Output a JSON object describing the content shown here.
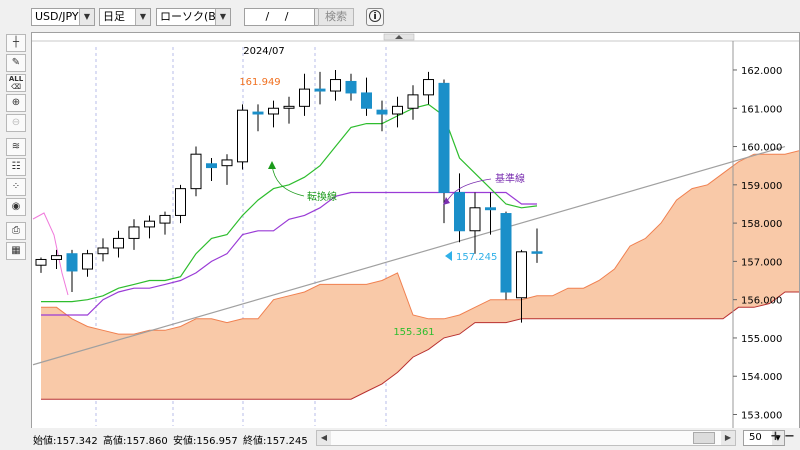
{
  "toolbar": {
    "symbol": "USD/JPY",
    "period": "日足",
    "chart_type": "ローソク(BID)",
    "date": "/ /",
    "search_label": "検索",
    "info_icon": "info-icon"
  },
  "sidebar": {
    "icons": [
      "crosshair-icon",
      "pencil-icon",
      "all-delete-icon",
      "zoom-in-icon",
      "zoom-out-icon",
      "technical-chart-icon",
      "list-icon",
      "grid-icon",
      "eye-icon",
      "print-icon",
      "calculator-icon"
    ],
    "all_label": "ALL"
  },
  "chart": {
    "date_label": "2024/07",
    "price_axis": [
      "162.000",
      "161.000",
      "160.000",
      "159.000",
      "158.000",
      "157.000",
      "156.000",
      "155.000",
      "154.000",
      "153.000"
    ],
    "high_label": "161.949",
    "low_label": "155.361",
    "current_label": "157.245",
    "kijun_label": "基準線",
    "tenkan_label": "転換線",
    "colors": {
      "up": "#ffffff",
      "down": "#1a8fc9",
      "tenkan": "#2ebd2e",
      "kijun": "#9a3bd6",
      "cloud": "#f9c9a8",
      "cloud_edge_a": "#f08050",
      "cloud_edge_b": "#b83030",
      "trend": "#a0a0a0",
      "high": "#f07020",
      "low": "#2ebd2e",
      "current": "#30b0e8"
    }
  },
  "chart_data": {
    "type": "candlestick",
    "ylim": [
      152.7,
      162.6
    ],
    "candles": [
      {
        "o": 156.9,
        "h": 157.1,
        "l": 156.7,
        "c": 157.05
      },
      {
        "o": 157.05,
        "h": 157.3,
        "l": 156.8,
        "c": 157.15
      },
      {
        "o": 157.2,
        "h": 157.3,
        "l": 156.2,
        "c": 156.75
      },
      {
        "o": 156.8,
        "h": 157.3,
        "l": 156.6,
        "c": 157.2
      },
      {
        "o": 157.2,
        "h": 157.6,
        "l": 157.0,
        "c": 157.35
      },
      {
        "o": 157.35,
        "h": 157.8,
        "l": 157.1,
        "c": 157.6
      },
      {
        "o": 157.6,
        "h": 158.1,
        "l": 157.3,
        "c": 157.9
      },
      {
        "o": 157.9,
        "h": 158.2,
        "l": 157.6,
        "c": 158.05
      },
      {
        "o": 158.0,
        "h": 158.3,
        "l": 157.7,
        "c": 158.2
      },
      {
        "o": 158.2,
        "h": 159.0,
        "l": 158.0,
        "c": 158.9
      },
      {
        "o": 158.9,
        "h": 160.0,
        "l": 158.7,
        "c": 159.8
      },
      {
        "o": 159.55,
        "h": 159.7,
        "l": 159.1,
        "c": 159.45
      },
      {
        "o": 159.5,
        "h": 159.8,
        "l": 159.0,
        "c": 159.65
      },
      {
        "o": 159.6,
        "h": 161.1,
        "l": 159.4,
        "c": 160.95
      },
      {
        "o": 160.9,
        "h": 161.1,
        "l": 160.4,
        "c": 160.85
      },
      {
        "o": 160.85,
        "h": 161.2,
        "l": 160.5,
        "c": 161.0
      },
      {
        "o": 161.0,
        "h": 161.3,
        "l": 160.6,
        "c": 161.05
      },
      {
        "o": 161.05,
        "h": 161.9,
        "l": 160.8,
        "c": 161.5
      },
      {
        "o": 161.5,
        "h": 161.95,
        "l": 161.1,
        "c": 161.45
      },
      {
        "o": 161.45,
        "h": 162.0,
        "l": 161.2,
        "c": 161.75
      },
      {
        "o": 161.7,
        "h": 161.9,
        "l": 161.2,
        "c": 161.4
      },
      {
        "o": 161.4,
        "h": 161.8,
        "l": 160.8,
        "c": 161.0
      },
      {
        "o": 160.95,
        "h": 161.2,
        "l": 160.4,
        "c": 160.85
      },
      {
        "o": 160.85,
        "h": 161.3,
        "l": 160.5,
        "c": 161.05
      },
      {
        "o": 161.0,
        "h": 161.6,
        "l": 160.7,
        "c": 161.35
      },
      {
        "o": 161.35,
        "h": 161.95,
        "l": 161.1,
        "c": 161.75
      },
      {
        "o": 161.65,
        "h": 161.75,
        "l": 158.0,
        "c": 158.8
      },
      {
        "o": 158.8,
        "h": 159.3,
        "l": 157.5,
        "c": 157.8
      },
      {
        "o": 157.8,
        "h": 158.8,
        "l": 157.2,
        "c": 158.4
      },
      {
        "o": 158.4,
        "h": 158.8,
        "l": 157.7,
        "c": 158.35
      },
      {
        "o": 158.25,
        "h": 158.3,
        "l": 156.0,
        "c": 156.2
      },
      {
        "o": 156.05,
        "h": 157.3,
        "l": 155.4,
        "c": 157.25
      },
      {
        "o": 157.25,
        "h": 157.86,
        "l": 156.96,
        "c": 157.245
      }
    ],
    "tenkan": [
      155.95,
      155.95,
      155.95,
      156.0,
      156.1,
      156.3,
      156.4,
      156.5,
      156.5,
      156.6,
      157.2,
      157.6,
      157.7,
      158.2,
      158.6,
      158.9,
      159.0,
      159.2,
      159.5,
      160.0,
      160.5,
      160.6,
      160.6,
      160.8,
      161.0,
      161.1,
      160.8,
      159.7,
      159.3,
      158.9,
      158.5,
      158.4,
      158.45
    ],
    "kijun": [
      155.6,
      155.6,
      155.6,
      155.6,
      156.0,
      156.2,
      156.3,
      156.3,
      156.4,
      156.5,
      156.7,
      157.0,
      157.2,
      157.7,
      157.8,
      157.8,
      158.1,
      158.2,
      158.4,
      158.7,
      158.8,
      158.8,
      158.8,
      158.8,
      158.8,
      158.8,
      158.8,
      158.8,
      158.8,
      158.8,
      158.8,
      158.5,
      158.5
    ],
    "cloud_top": [
      155.8,
      155.8,
      155.5,
      155.3,
      155.2,
      155.1,
      155.1,
      155.2,
      155.2,
      155.3,
      155.5,
      155.5,
      155.4,
      155.5,
      155.5,
      156.0,
      156.1,
      156.2,
      156.4,
      156.4,
      156.4,
      156.4,
      156.5,
      156.7,
      155.6,
      155.5,
      155.5,
      155.6,
      155.8,
      156.0,
      156.0,
      156.0,
      156.1,
      156.1,
      156.3,
      156.3,
      156.5,
      156.8,
      157.4,
      157.6,
      158.0,
      158.6,
      158.9,
      159.0,
      159.3,
      159.6,
      159.8,
      159.8,
      159.8,
      159.9,
      159.9,
      159.9,
      159.9,
      159.9,
      159.9,
      159.9,
      159.9,
      160.0,
      159.1,
      159.1,
      159.2
    ],
    "cloud_bottom": [
      153.4,
      153.4,
      153.4,
      153.4,
      153.4,
      153.4,
      153.4,
      153.4,
      153.4,
      153.4,
      153.4,
      153.4,
      153.4,
      153.4,
      153.4,
      153.4,
      153.4,
      153.4,
      153.4,
      153.4,
      153.4,
      153.6,
      153.8,
      154.1,
      154.5,
      154.7,
      155.0,
      155.1,
      155.4,
      155.4,
      155.4,
      155.5,
      155.5,
      155.5,
      155.5,
      155.5,
      155.5,
      155.5,
      155.5,
      155.5,
      155.5,
      155.5,
      155.5,
      155.5,
      155.5,
      155.8,
      155.8,
      155.9,
      156.2,
      156.2,
      156.3,
      156.5,
      156.5,
      156.6,
      156.7,
      156.9,
      156.9,
      156.9,
      156.9,
      156.9,
      156.9
    ],
    "trendline": {
      "from": [
        0,
        154.3
      ],
      "to": [
        48,
        160.0
      ]
    }
  },
  "status": {
    "open_label": "始値:",
    "open_value": "157.342",
    "high_label": "高値:",
    "high_value": "157.860",
    "low_label": "安値:",
    "low_value": "156.957",
    "close_label": "終値:",
    "close_value": "157.245",
    "zoom": "50"
  }
}
